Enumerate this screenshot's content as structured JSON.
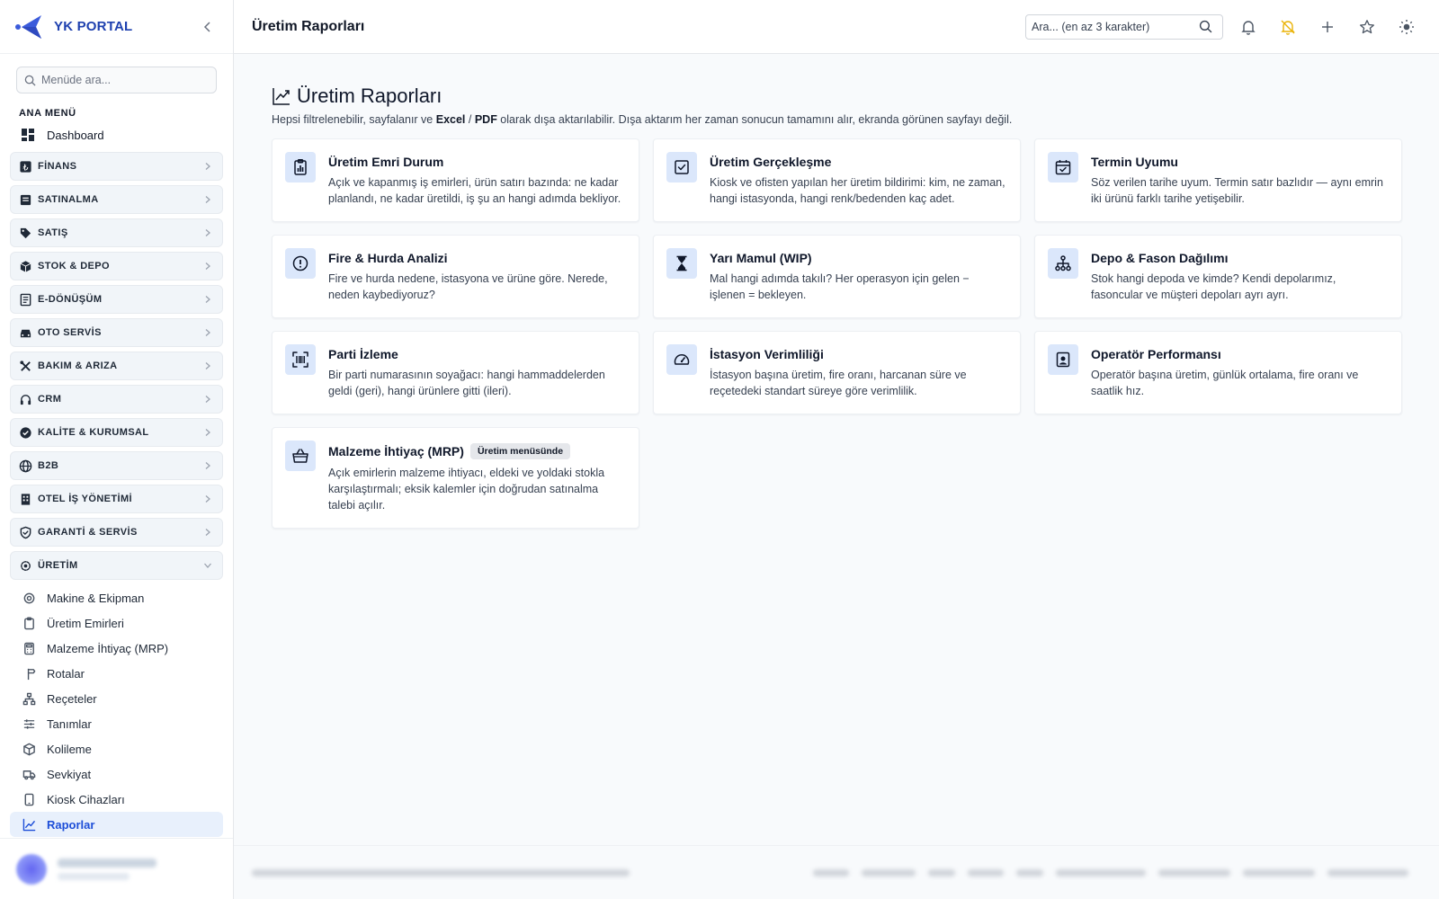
{
  "brand": {
    "name": "YK PORTAL"
  },
  "sidebar": {
    "search_placeholder": "Menüde ara...",
    "section_title": "ANA MENÜ",
    "dashboard_label": "Dashboard",
    "groups": [
      {
        "label": "FİNANS",
        "icon": "bank-icon"
      },
      {
        "label": "SATINALMA",
        "icon": "cart-icon"
      },
      {
        "label": "SATIŞ",
        "icon": "tag-icon"
      },
      {
        "label": "STOK & DEPO",
        "icon": "box-icon"
      },
      {
        "label": "E-DÖNÜŞÜM",
        "icon": "receipt-icon"
      },
      {
        "label": "OTO SERVİS",
        "icon": "car-icon"
      },
      {
        "label": "BAKIM & ARIZA",
        "icon": "tools-icon"
      },
      {
        "label": "CRM",
        "icon": "headset-icon"
      },
      {
        "label": "KALİTE & KURUMSAL",
        "icon": "verified-icon"
      },
      {
        "label": "B2B",
        "icon": "globe-icon"
      },
      {
        "label": "OTEL İŞ YÖNETİMİ",
        "icon": "building-icon"
      },
      {
        "label": "GARANTİ & SERVİS",
        "icon": "shield-icon"
      },
      {
        "label": "ÜRETİM",
        "icon": "gear-icon"
      }
    ],
    "uretim_items": [
      {
        "label": "Makine & Ekipman",
        "icon": "cog-icon"
      },
      {
        "label": "Üretim Emirleri",
        "icon": "clipboard-icon"
      },
      {
        "label": "Malzeme İhtiyaç (MRP)",
        "icon": "calculator-icon"
      },
      {
        "label": "Rotalar",
        "icon": "signpost-icon"
      },
      {
        "label": "Reçeteler",
        "icon": "hierarchy-icon"
      },
      {
        "label": "Tanımlar",
        "icon": "sliders-icon"
      },
      {
        "label": "Kolileme",
        "icon": "package-icon"
      },
      {
        "label": "Sevkiyat",
        "icon": "truck-icon"
      },
      {
        "label": "Kiosk Cihazları",
        "icon": "tablet-icon"
      },
      {
        "label": "Raporlar",
        "icon": "chart-line-icon"
      }
    ]
  },
  "topbar": {
    "title": "Üretim Raporları",
    "search_placeholder": "Ara... (en az 3 karakter)"
  },
  "page": {
    "title": "Üretim Raporları",
    "desc_pre": "Hepsi filtrelenebilir, sayfalanır ve ",
    "desc_excel": "Excel",
    "desc_sep": " / ",
    "desc_pdf": "PDF",
    "desc_post": " olarak dışa aktarılabilir. Dışa aktarım her zaman sonucun tamamını alır, ekranda görünen sayfayı değil."
  },
  "cards": [
    {
      "title": "Üretim Emri Durum",
      "desc": "Açık ve kapanmış iş emirleri, ürün satırı bazında: ne kadar planlandı, ne kadar üretildi, iş şu an hangi adımda bekliyor.",
      "icon": "clipboard-chart-icon"
    },
    {
      "title": "Üretim Gerçekleşme",
      "desc": "Kiosk ve ofisten yapılan her üretim bildirimi: kim, ne zaman, hangi istasyonda, hangi renk/bedenden kaç adet.",
      "icon": "check-square-icon"
    },
    {
      "title": "Termin Uyumu",
      "desc": "Söz verilen tarihe uyum. Termin satır bazlıdır — aynı emrin iki ürünü farklı tarihe yetişebilir.",
      "icon": "calendar-check-icon"
    },
    {
      "title": "Fire & Hurda Analizi",
      "desc": "Fire ve hurda nedene, istasyona ve ürüne göre. Nerede, neden kaybediyoruz?",
      "icon": "alert-octagon-icon"
    },
    {
      "title": "Yarı Mamul (WIP)",
      "desc": "Mal hangi adımda takılı? Her operasyon için gelen − işlenen = bekleyen.",
      "icon": "hourglass-icon"
    },
    {
      "title": "Depo & Fason Dağılımı",
      "desc": "Stok hangi depoda ve kimde? Kendi depolarımız, fasoncular ve müşteri depoları ayrı ayrı.",
      "icon": "sitemap-icon"
    },
    {
      "title": "Parti İzleme",
      "desc": "Bir parti numarasının soyağacı: hangi hammaddelerden geldi (geri), hangi ürünlere gitti (ileri).",
      "icon": "barcode-scan-icon"
    },
    {
      "title": "İstasyon Verimliliği",
      "desc": "İstasyon başına üretim, fire oranı, harcanan süre ve reçetedeki standart süreye göre verimlilik.",
      "icon": "gauge-icon"
    },
    {
      "title": "Operatör Performansı",
      "desc": "Operatör başına üretim, günlük ortalama, fire oranı ve saatlik hız.",
      "icon": "badge-user-icon"
    },
    {
      "title": "Malzeme İhtiyaç (MRP)",
      "desc": "Açık emirlerin malzeme ihtiyacı, eldeki ve yoldaki stokla karşılaştırmalı; eksik kalemler için doğrudan satınalma talebi açılır.",
      "icon": "basket-icon",
      "badge": "Üretim menüsünde"
    }
  ],
  "colors": {
    "brand": "#1e40af",
    "active": "#1d4ed8",
    "card_icon_bg": "#dbe7fb",
    "alarm_icon": "#eab308"
  }
}
